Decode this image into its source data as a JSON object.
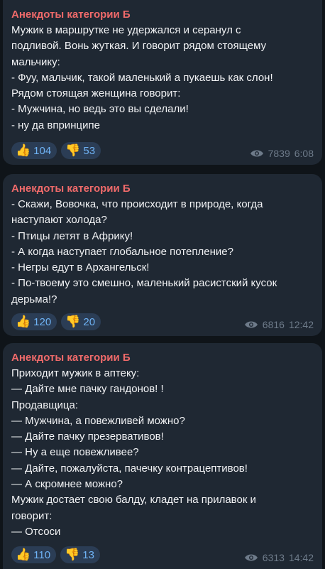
{
  "messages": [
    {
      "channel": "Анекдоты категории Б",
      "lines": [
        "Мужик в маршрутке не удержался и серанул с",
        "подливой. Вонь жуткая. И говорит рядом стоящему",
        "мальчику:",
        "- Фуу, мальчик, такой маленький а пукаешь как слон!",
        "Рядом стоящая женщина говорит:",
        "- Мужчина, но ведь это вы сделали!",
        "- ну да впринципе"
      ],
      "reactions": [
        {
          "emoji_icon": "thumbs-up-icon",
          "emoji": "👍",
          "count": "104"
        },
        {
          "emoji_icon": "thumbs-down-icon",
          "emoji": "👎",
          "count": "53"
        }
      ],
      "views": "7839",
      "time": "6:08"
    },
    {
      "channel": "Анекдоты категории Б",
      "lines": [
        "- Скажи, Вовочка, что происходит в природе, когда",
        "наступают холода?",
        "- Птицы летят в Африку!",
        "- А когда наступает глобальное потепление?",
        "- Негры едут в Архангельск!",
        "- По-твоему это смешно, маленький расистский кусок",
        "дерьма!?"
      ],
      "reactions": [
        {
          "emoji_icon": "thumbs-up-icon",
          "emoji": "👍",
          "count": "120"
        },
        {
          "emoji_icon": "thumbs-down-icon",
          "emoji": "👎",
          "count": "20"
        }
      ],
      "views": "6816",
      "time": "12:42"
    },
    {
      "channel": "Анекдоты категории Б",
      "lines": [
        "Приходит мужик в аптеку:",
        "— Дайте мне пачку гандонов! !",
        "Продавщица:",
        "— Мужчина, а повежливей можно?",
        "— Дайте пачку презервативов!",
        "— Ну а еще повежливее?",
        "— Дайте, пожалуйста, пачечку контрацептивов!",
        "— А скромнее можно?",
        "Мужик достает свою балду, кладет на прилавок и",
        "говорит:",
        "— Отсоси"
      ],
      "reactions": [
        {
          "emoji_icon": "thumbs-up-icon",
          "emoji": "👍",
          "count": "110"
        },
        {
          "emoji_icon": "thumbs-down-icon",
          "emoji": "👎",
          "count": "13"
        }
      ],
      "views": "6313",
      "time": "14:42"
    }
  ],
  "colors": {
    "background": "#0f1419",
    "bubble": "#1f2833",
    "channel_name": "#ef6a6a",
    "reaction_bg": "#2b3d55",
    "reaction_text": "#6fb3f5",
    "meta_text": "#6e7b8a"
  }
}
